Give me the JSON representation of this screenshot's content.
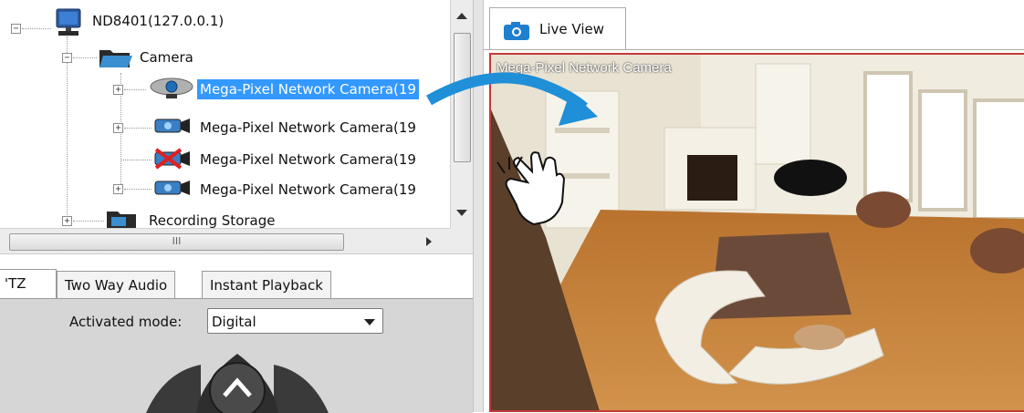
{
  "tree": {
    "root": {
      "label": "ND8401(127.0.0.1)",
      "expander": "−"
    },
    "camera_folder": {
      "label": "Camera",
      "expander": "−"
    },
    "cameras": [
      {
        "label": "Mega-Pixel Network Camera(19",
        "state": "selected",
        "expander": "+"
      },
      {
        "label": "Mega-Pixel Network Camera(19",
        "state": "normal",
        "expander": "+"
      },
      {
        "label": "Mega-Pixel Network Camera(19",
        "state": "disconnected",
        "expander": ""
      },
      {
        "label": "Mega-Pixel Network Camera(19",
        "state": "normal",
        "expander": "+"
      }
    ],
    "recording_storage": {
      "label": "Recording Storage",
      "expander": "+"
    }
  },
  "hscroll": {
    "grip": "III"
  },
  "tabs": [
    {
      "label": "'TZ",
      "active": true
    },
    {
      "label": "Two Way Audio",
      "active": false
    },
    {
      "label": "Instant Playback",
      "active": false
    }
  ],
  "ptz_panel": {
    "mode_label": "Activated mode:",
    "mode_value": "Digital"
  },
  "live_view": {
    "tab_label": "Live View",
    "camera_title": "Mega-Pixel Network Camera"
  },
  "colors": {
    "selection": "#3399ff",
    "view_border": "#c43a3a",
    "arrow": "#1f8fd8"
  },
  "icons": [
    "computer-icon",
    "folder-open-icon",
    "camera-icon",
    "camera-disconnected-icon",
    "folder-icon",
    "hand-pointer-icon",
    "curved-arrow-icon",
    "chevron-up-icon"
  ]
}
